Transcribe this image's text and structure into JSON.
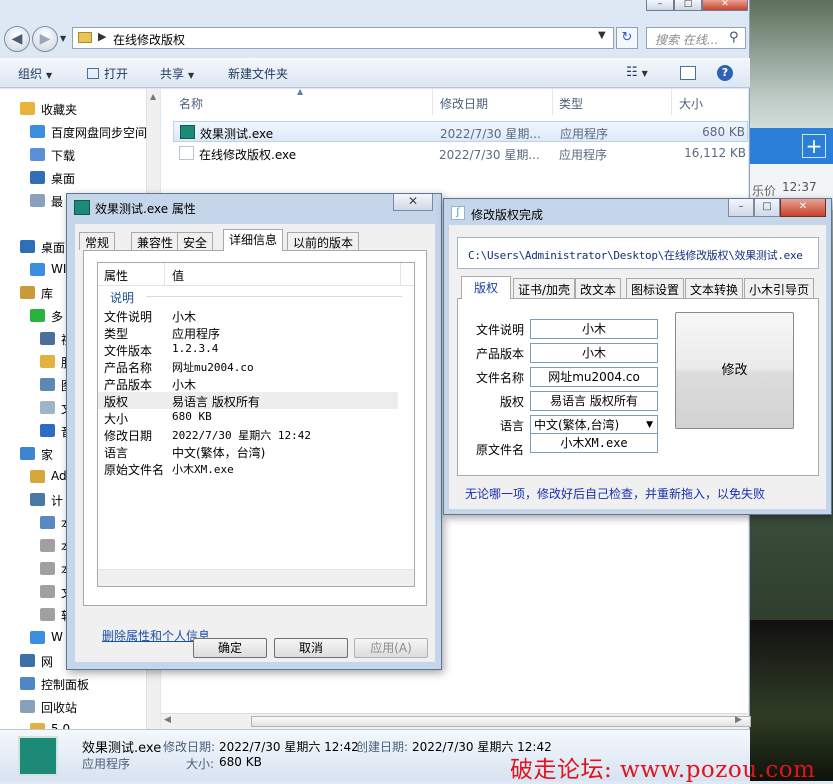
{
  "explorer": {
    "title_buttons": [
      "–",
      "□",
      "✕"
    ],
    "address": {
      "path": "在线修改版权"
    },
    "search": {
      "placeholder": "搜索 在线..."
    },
    "toolbar": {
      "organize": "组织",
      "open": "打开",
      "share": "共享",
      "new_folder": "新建文件夹"
    },
    "nav": [
      {
        "label": "收藏夹",
        "icon": "star-icon",
        "color": "#e8b43a"
      },
      {
        "label": "百度网盘同步空间",
        "icon": "baidu-sync-icon",
        "color": "#3b8ee0"
      },
      {
        "label": "下载",
        "icon": "download-folder-icon",
        "color": "#5b8fd6"
      },
      {
        "label": "桌面",
        "icon": "desktop-icon",
        "color": "#2f6fb8"
      },
      {
        "label": "最",
        "icon": "recent-icon",
        "color": "#8aa1bd"
      },
      {
        "label": "桌面",
        "icon": "desktop-icon",
        "color": "#2f6fb8"
      },
      {
        "label": "WI",
        "icon": "cloud-icon",
        "color": "#3b8ee0"
      },
      {
        "label": "库",
        "icon": "library-icon",
        "color": "#c99a3a"
      },
      {
        "label": "多",
        "icon": "iqiyi-icon",
        "color": "#28b43c"
      },
      {
        "label": "视",
        "icon": "video-icon",
        "color": "#4a6f9a"
      },
      {
        "label": "服",
        "icon": "folder-icon",
        "color": "#e2b23e"
      },
      {
        "label": "图",
        "icon": "pictures-icon",
        "color": "#5d87b6"
      },
      {
        "label": "文",
        "icon": "documents-icon",
        "color": "#9fb3c9"
      },
      {
        "label": "音",
        "icon": "music-icon",
        "color": "#2c6cc3"
      },
      {
        "label": "家",
        "icon": "homegroup-icon",
        "color": "#3a86d1"
      },
      {
        "label": "Ad",
        "icon": "user-folder-icon",
        "color": "#d6a83c"
      },
      {
        "label": "计",
        "icon": "computer-icon",
        "color": "#4c78a8"
      },
      {
        "label": "本",
        "icon": "os-drive-icon",
        "color": "#5b88c1"
      },
      {
        "label": "本",
        "icon": "drive-icon",
        "color": "#a0a0a0"
      },
      {
        "label": "本",
        "icon": "drive-icon",
        "color": "#a0a0a0"
      },
      {
        "label": "文",
        "icon": "drive-icon",
        "color": "#a0a0a0"
      },
      {
        "label": "软",
        "icon": "drive-icon",
        "color": "#a0a0a0"
      },
      {
        "label": "W",
        "icon": "cloud-icon",
        "color": "#3b8ee0"
      },
      {
        "label": "网",
        "icon": "network-icon",
        "color": "#3d6fa8"
      },
      {
        "label": "控制面板",
        "icon": "control-panel-icon",
        "color": "#4f86c6"
      },
      {
        "label": "回收站",
        "icon": "recycle-bin-icon",
        "color": "#8aa0b8"
      },
      {
        "label": "5.0",
        "icon": "folder-icon",
        "color": "#e2b23e"
      }
    ],
    "columns": {
      "name": "名称",
      "modified": "修改日期",
      "type": "类型",
      "size": "大小"
    },
    "files": [
      {
        "name": "效果测试.exe",
        "modified": "2022/7/30 星期...",
        "type": "应用程序",
        "size": "680 KB",
        "icon": "app-green-icon",
        "selected": true
      },
      {
        "name": "在线修改版权.exe",
        "modified": "2022/7/30 星期...",
        "type": "应用程序",
        "size": "16,112 KB",
        "icon": "tool-exe-icon",
        "selected": false
      }
    ],
    "details": {
      "filename": "效果测试.exe",
      "modified_label": "修改日期:",
      "modified_value": "2022/7/30 星期六 12:42",
      "created_label": "创建日期:",
      "created_value": "2022/7/30 星期六 12:42",
      "type": "应用程序",
      "size_label": "大小:",
      "size_value": "680 KB"
    }
  },
  "desktop": {
    "side_text": "乐价",
    "time": "12:37",
    "plus": "+"
  },
  "properties": {
    "title": "效果测试.exe 属性",
    "close": "✕",
    "tabs": [
      "常规",
      "兼容性",
      "安全",
      "详细信息",
      "以前的版本"
    ],
    "active_tab": "详细信息",
    "headers": {
      "prop": "属性",
      "value": "值"
    },
    "group": "说明",
    "rows": [
      {
        "key": "文件说明",
        "value": "小木"
      },
      {
        "key": "类型",
        "value": "应用程序"
      },
      {
        "key": "文件版本",
        "value": "1.2.3.4"
      },
      {
        "key": "产品名称",
        "value": "网址mu2004.co"
      },
      {
        "key": "产品版本",
        "value": "小木"
      },
      {
        "key": "版权",
        "value": "易语言 版权所有"
      },
      {
        "key": "大小",
        "value": "680 KB"
      },
      {
        "key": "修改日期",
        "value": "2022/7/30 星期六 12:42"
      },
      {
        "key": "语言",
        "value": "中文(繁体，台湾)"
      },
      {
        "key": "原始文件名",
        "value": "小木XM.exe"
      }
    ],
    "remove_link": "删除属性和个人信息",
    "buttons": {
      "ok": "确定",
      "cancel": "取消",
      "apply": "应用(A)"
    }
  },
  "tool": {
    "title": "修改版权完成",
    "window_buttons": [
      "–",
      "□",
      "✕"
    ],
    "path": "C:\\Users\\Administrator\\Desktop\\在线修改版权\\效果测试.exe",
    "tabs": [
      "版权",
      "证书/加壳",
      "改文本",
      "图标设置",
      "文本转换",
      "小木引导页"
    ],
    "active_tab": "版权",
    "fields": [
      {
        "label": "文件说明",
        "value": "小木"
      },
      {
        "label": "产品版本",
        "value": "小木"
      },
      {
        "label": "文件名称",
        "value": "网址mu2004.co"
      },
      {
        "label": "版权",
        "value": "易语言 版权所有"
      },
      {
        "label": "语言",
        "value": "中文(繁体,台湾)"
      },
      {
        "label": "原文件名",
        "value": "小木XM.exe"
      }
    ],
    "modify_button": "修改",
    "hint": "无论哪一项，修改好后自己检查，并重新拖入，以免失败"
  },
  "watermark": "破走论坛: www.pozou.com"
}
